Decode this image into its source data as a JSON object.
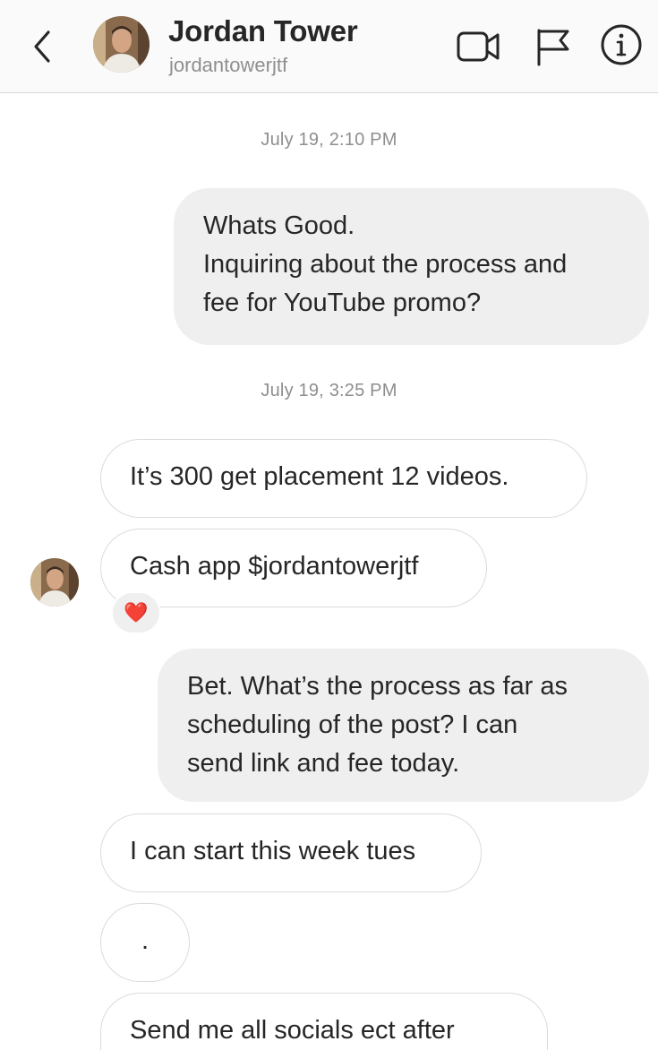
{
  "header": {
    "name": "Jordan Tower",
    "username": "jordantowerjtf",
    "icons": {
      "back": "chevron-left-icon",
      "video": "video-camera-icon",
      "flag": "flag-icon",
      "info": "info-icon"
    }
  },
  "thread": {
    "timestamps": [
      "July 19, 2:10 PM",
      "July 19, 3:25 PM"
    ],
    "messages": [
      {
        "direction": "sent",
        "lines": [
          "Whats Good.",
          "Inquiring about the process and",
          "fee for YouTube promo?"
        ]
      },
      {
        "direction": "received",
        "lines": [
          "It’s 300 get placement 12 videos."
        ]
      },
      {
        "direction": "received",
        "lines": [
          "Cash app $jordantowerjtf"
        ],
        "reaction": "❤️"
      },
      {
        "direction": "sent",
        "lines": [
          "Bet. What’s the process as far as",
          "scheduling of the post? I can",
          "send link and fee today."
        ]
      },
      {
        "direction": "received",
        "lines": [
          "I can start this week tues"
        ]
      },
      {
        "direction": "received",
        "lines": [
          "."
        ]
      },
      {
        "direction": "received",
        "lines": [
          "Send me all socials ect after"
        ]
      }
    ]
  },
  "colors": {
    "header_bg": "#fafafa",
    "sent_bubble": "#efefef",
    "received_border": "#dbdbdb",
    "text": "#262626",
    "secondary_text": "#8e8e8e",
    "reaction": "#ed4956"
  }
}
